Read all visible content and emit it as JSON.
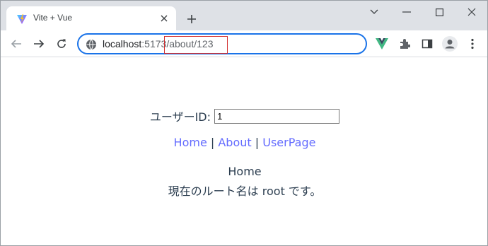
{
  "browser": {
    "tab": {
      "title": "Vite + Vue"
    },
    "address": {
      "host": "localhost",
      "port_path_host": ":5173",
      "path": "/about/123"
    }
  },
  "page": {
    "user_id_label": "ユーザーID:",
    "user_id_value": "1",
    "nav": [
      {
        "label": "Home"
      },
      {
        "label": "About"
      },
      {
        "label": "UserPage"
      }
    ],
    "separator": "|",
    "view_title": "Home",
    "view_text": "現在のルート名は root です。"
  },
  "colors": {
    "link": "#646cff",
    "text": "#2c3e50",
    "omnibox_border": "#1a73e8",
    "highlight": "#d32f2f"
  },
  "icons": [
    "vite-logo-icon",
    "close-icon",
    "plus-icon",
    "chevron-down-icon",
    "minimize-icon",
    "maximize-icon",
    "close-window-icon",
    "back-icon",
    "forward-icon",
    "reload-icon",
    "site-info-icon",
    "vue-devtools-icon",
    "extensions-icon",
    "side-panel-icon",
    "profile-icon",
    "menu-icon"
  ]
}
